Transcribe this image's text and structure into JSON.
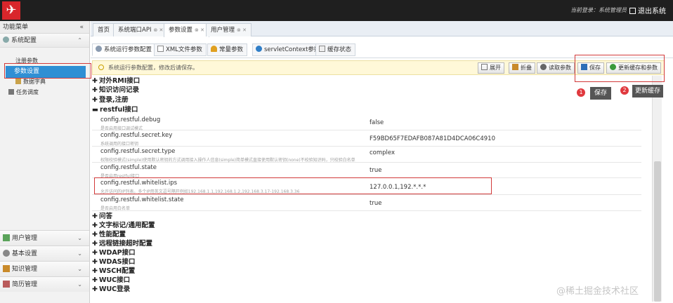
{
  "header": {
    "logo_text": "✈",
    "user_info": "当前登录：系统管理员",
    "logout_label": "退出系统"
  },
  "sidebar": {
    "title": "功能菜单",
    "collapse_glyph": "«",
    "group_system": "系统配置",
    "tree": [
      {
        "label": "注册参数"
      },
      {
        "label": "参数设置"
      },
      {
        "label": "数据字典"
      },
      {
        "label": "任务调度"
      }
    ],
    "bottom_groups": [
      {
        "label": "用户管理"
      },
      {
        "label": "基本设置"
      },
      {
        "label": "知识管理"
      },
      {
        "label": "简历管理"
      }
    ]
  },
  "tabs": [
    {
      "label": "首页"
    },
    {
      "label": "系统端口API"
    },
    {
      "label": "参数设置"
    },
    {
      "label": "用户管理"
    }
  ],
  "subtabs": [
    {
      "label": "系统运行参数配置"
    },
    {
      "label": "XML文件参数"
    },
    {
      "label": "常量参数"
    },
    {
      "label": "servletContext参数"
    },
    {
      "label": "缓存状态"
    }
  ],
  "toolbar": {
    "hint": "系统运行参数配置，修改后请保存。",
    "expand": "展开",
    "collapse": "折叠",
    "read": "读取参数",
    "save": "保存",
    "update_cache_params": "更新缓存和参数"
  },
  "groups_top": [
    {
      "label": "对外RMI接口"
    },
    {
      "label": "知识访问记录"
    },
    {
      "label": "登录,注册"
    },
    {
      "label": "restful接口"
    }
  ],
  "rows": [
    {
      "key": "config.restful.debug",
      "desc": "是否启用接口调试模式",
      "value": "false"
    },
    {
      "key": "config.restful.secret.key",
      "desc": "系统调用的接口密钥",
      "value": "F59BD65F7EDAFB087A81D4DCA06C4910"
    },
    {
      "key": "config.restful.secret.type",
      "desc": "权限校验模式(simple)使用默认密钥的方式调用接入操作人信息(simple)简单模式直接使用默认密钥(none)不校验知识码，只校验白名单",
      "value": "complex"
    },
    {
      "key": "config.restful.state",
      "desc": "是否启用restful接口",
      "value": "true"
    },
    {
      "key": "config.restful.whitelist.ips",
      "desc": "允许访问的IP列表。多个IP用英文逗号隔开例如192.168.1.1,192.168.1.2,192.168.3.17-192.168.3.36",
      "value": "127.0.0.1,192.*.*.*"
    },
    {
      "key": "config.restful.whitelist.state",
      "desc": "是否启用白名单",
      "value": "true"
    }
  ],
  "groups_bottom": [
    {
      "label": "问答"
    },
    {
      "label": "文字标记/通用配置"
    },
    {
      "label": "性能配置"
    },
    {
      "label": "远程链接超时配置"
    },
    {
      "label": "WDAP接口"
    },
    {
      "label": "WDAS接口"
    },
    {
      "label": "WSCH配置"
    },
    {
      "label": "WUC接口"
    },
    {
      "label": "WUC登录"
    }
  ],
  "callouts": [
    {
      "number": "1",
      "label": "保存"
    },
    {
      "number": "2",
      "label": "更新缓存"
    }
  ],
  "watermark": "@稀土掘金技术社区"
}
